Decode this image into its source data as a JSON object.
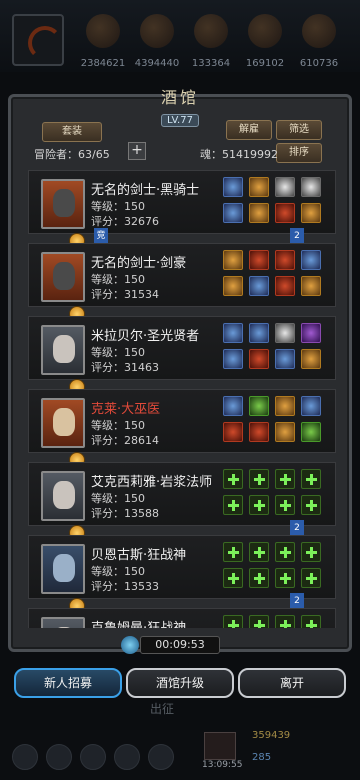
{
  "top": {
    "resources": [
      "2384621",
      "4394440",
      "133364",
      "169102",
      "610736"
    ]
  },
  "tavern": {
    "title": "酒馆",
    "level": "LV.77",
    "btn_suit": "套装",
    "btn_dismiss": "解雇",
    "btn_filter": "筛选",
    "btn_sort": "排序",
    "adventurers": "冒险者：63/65",
    "plus": "+",
    "soul": "魂：51419992"
  },
  "heroes": [
    {
      "name": "无名的剑士·黑骑士",
      "level": "等级：150",
      "score": "评分：32676",
      "tag_left": "竞",
      "tag_right": "2"
    },
    {
      "name": "无名的剑士·剑豪",
      "level": "等级：150",
      "score": "评分：31534",
      "tag_right": "2"
    },
    {
      "name": "米拉贝尔·圣光贤者",
      "level": "等级：150",
      "score": "评分：31463"
    },
    {
      "name": "克莱·大巫医",
      "level": "等级：150",
      "score": "评分：28614"
    },
    {
      "name": "艾克西莉雅·岩浆法师",
      "level": "等级：150",
      "score": "评分：13588",
      "tag_right": "2"
    },
    {
      "name": "贝恩古斯·狂战神",
      "level": "等级：150",
      "score": "评分：13533",
      "tag_right": "2"
    },
    {
      "name": "克鲁姆曼·狂战神",
      "level": "",
      "score": ""
    }
  ],
  "timer": "00:09:53",
  "buttons": {
    "recruit": "新人招募",
    "upgrade": "酒馆升级",
    "leave": "离开"
  },
  "bottom": {
    "expedition": "出征",
    "time": "13:09:55",
    "gold": "359439",
    "blue": "285"
  },
  "colors": {
    "accent_blue": "#3aa0e8",
    "hero_red_name": "#e24a3a",
    "empty_slot_green": "#7cf05a"
  }
}
